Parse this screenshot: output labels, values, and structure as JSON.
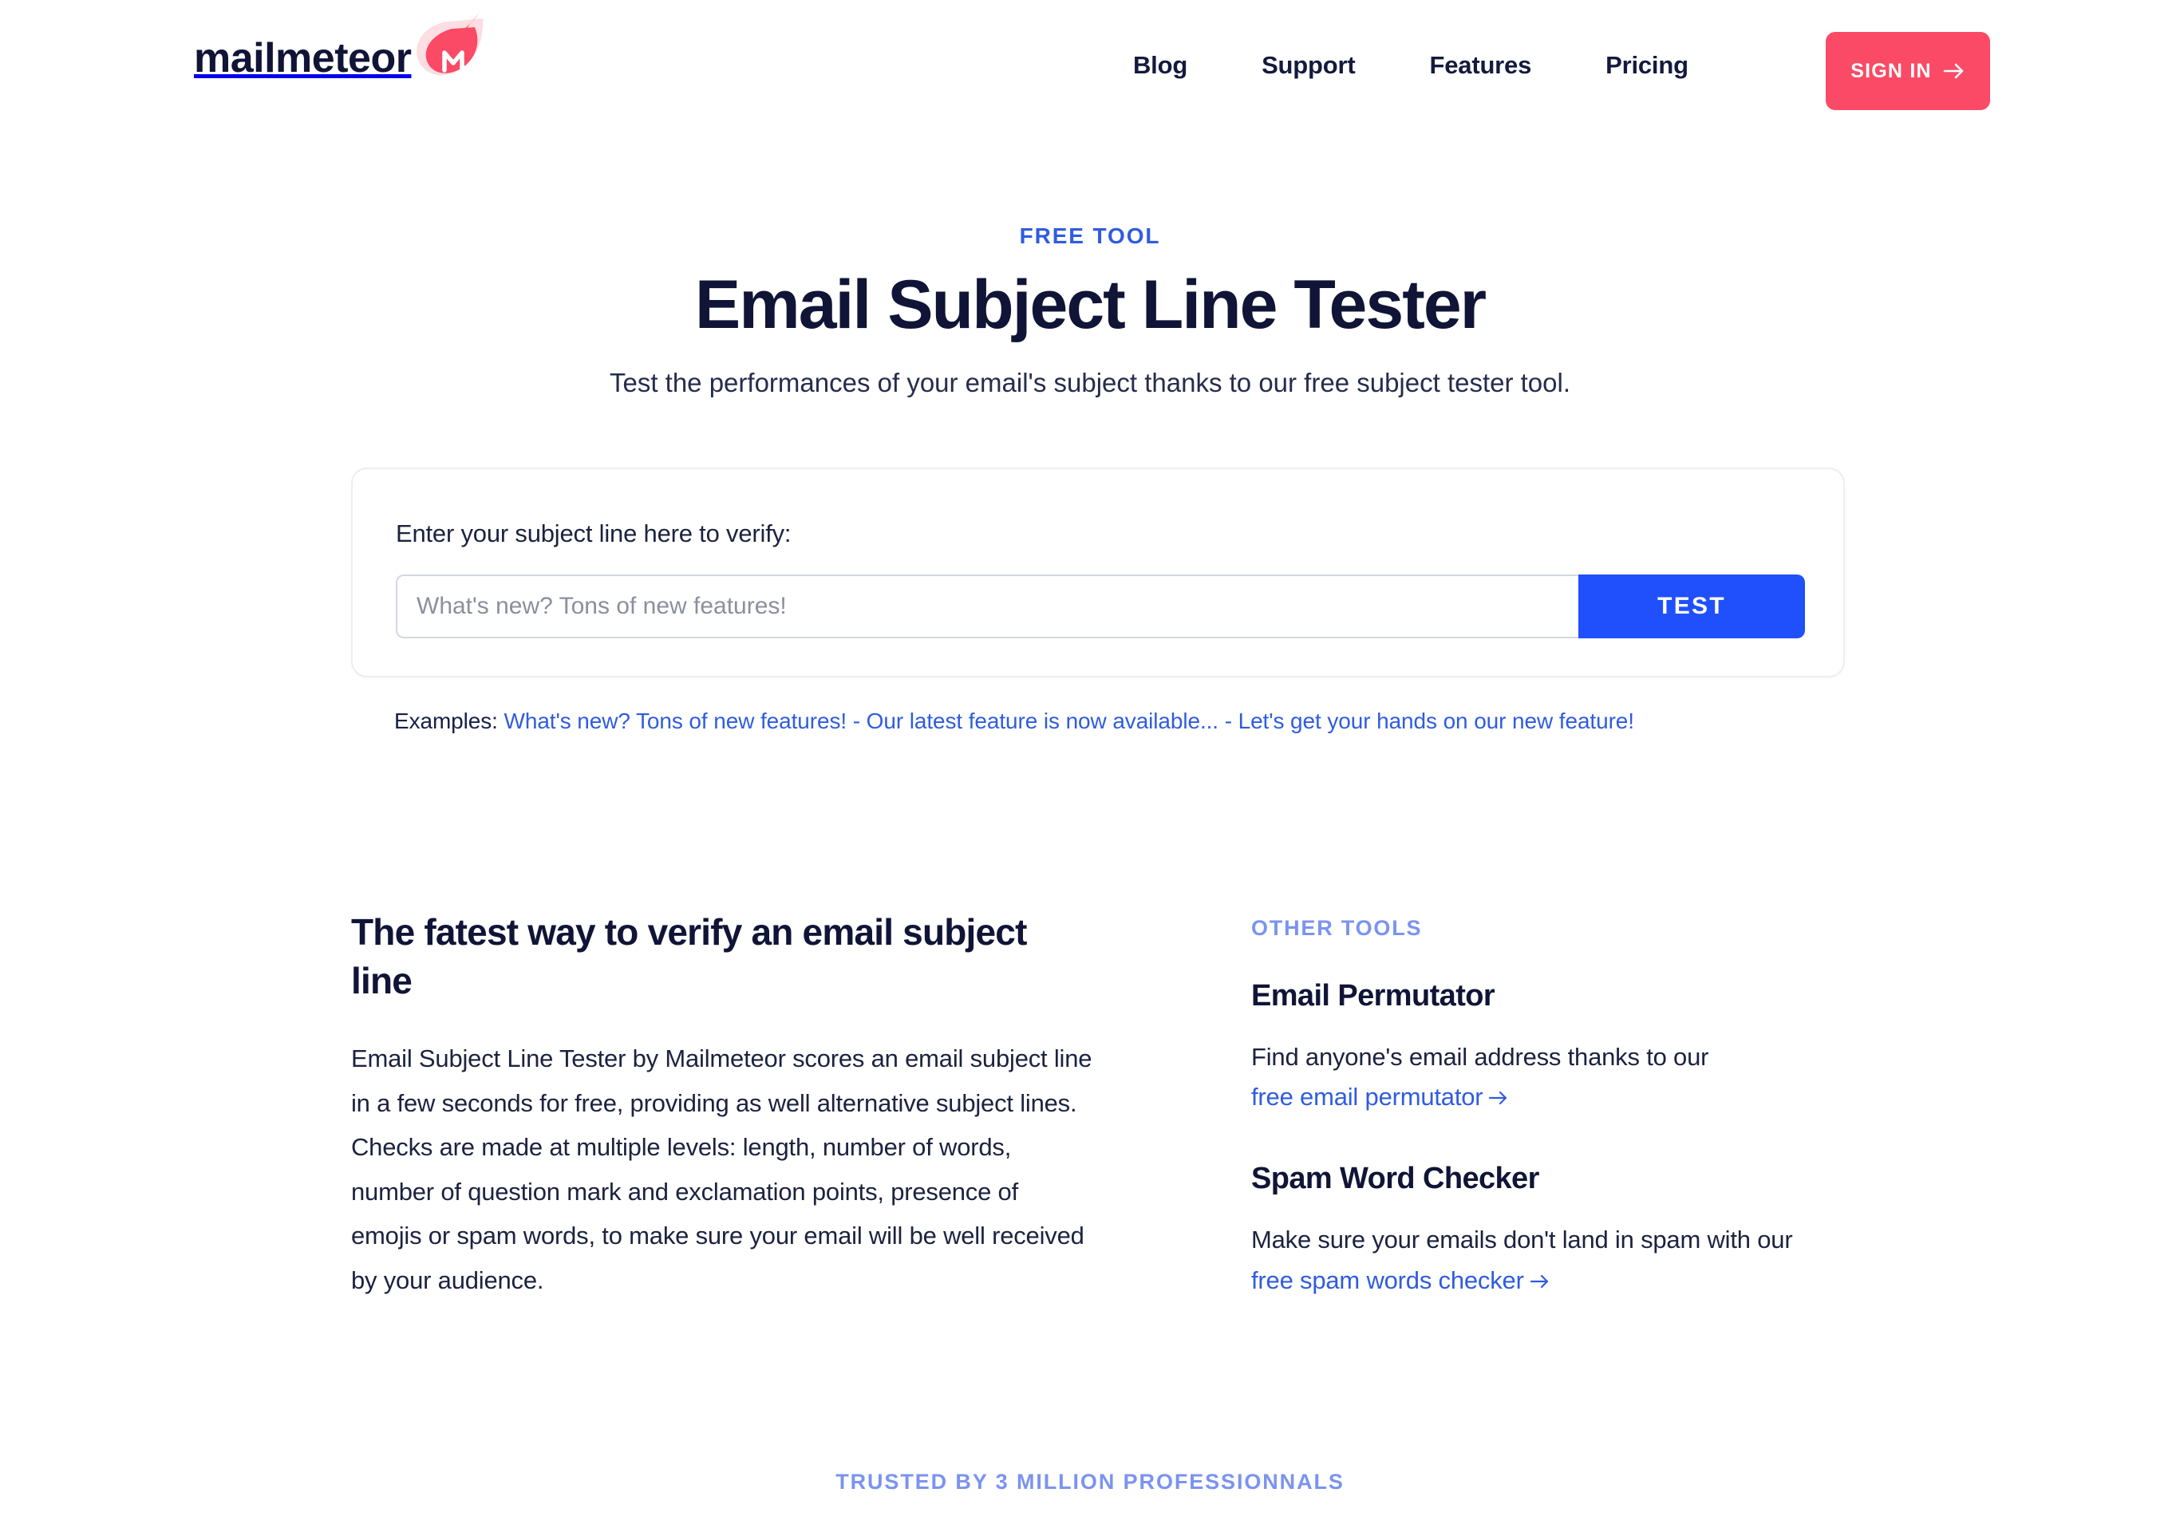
{
  "brand": {
    "name": "mailmeteor",
    "mark_letter": "M",
    "accent_pink": "#fb4a65",
    "accent_pink_light": "#fbd3da",
    "navy": "#101537",
    "blue": "#2050fb",
    "blue_link": "#2f5ce0",
    "blue_soft": "#7b93f0"
  },
  "header": {
    "nav": [
      {
        "label": "Blog"
      },
      {
        "label": "Support"
      },
      {
        "label": "Features"
      },
      {
        "label": "Pricing"
      }
    ],
    "signin_label": "SIGN IN",
    "signin_icon": "arrow-right-icon"
  },
  "hero": {
    "eyebrow": "FREE TOOL",
    "title": "Email Subject Line Tester",
    "subtitle": "Test the performances of your email's subject thanks to our free subject tester tool."
  },
  "form": {
    "label": "Enter your subject line here to verify:",
    "input_value": "",
    "input_placeholder": "What's new? Tons of new features!",
    "submit_label": "TEST"
  },
  "examples": {
    "label": "Examples:",
    "separator": "-",
    "items": [
      {
        "label": "What's new? Tons of new features!"
      },
      {
        "label": "Our latest feature is now available..."
      },
      {
        "label": "Let's get your hands on our new feature!"
      }
    ]
  },
  "about": {
    "heading": "The fatest way to verify an email subject line",
    "body": "Email Subject Line Tester by Mailmeteor scores an email subject line in a few seconds for free, providing as well alternative subject lines. Checks are made at multiple levels: length, number of words, number of question mark and exclamation points, presence of emojis or spam words, to make sure your email will be well received by your audience."
  },
  "other_tools": {
    "label": "OTHER TOOLS",
    "items": [
      {
        "title": "Email Permutator",
        "desc_before": "Find anyone's email address thanks to our ",
        "link": "free email permutator",
        "desc_after": "",
        "link_icon": "arrow-right-icon"
      },
      {
        "title": "Spam Word Checker",
        "desc_before": "Make sure your emails don't land in spam with our ",
        "link": "free spam words checker",
        "desc_after": "",
        "link_icon": "arrow-right-icon"
      }
    ]
  },
  "footer": {
    "trusted": "TRUSTED BY 3 MILLION PROFESSIONNALS"
  }
}
